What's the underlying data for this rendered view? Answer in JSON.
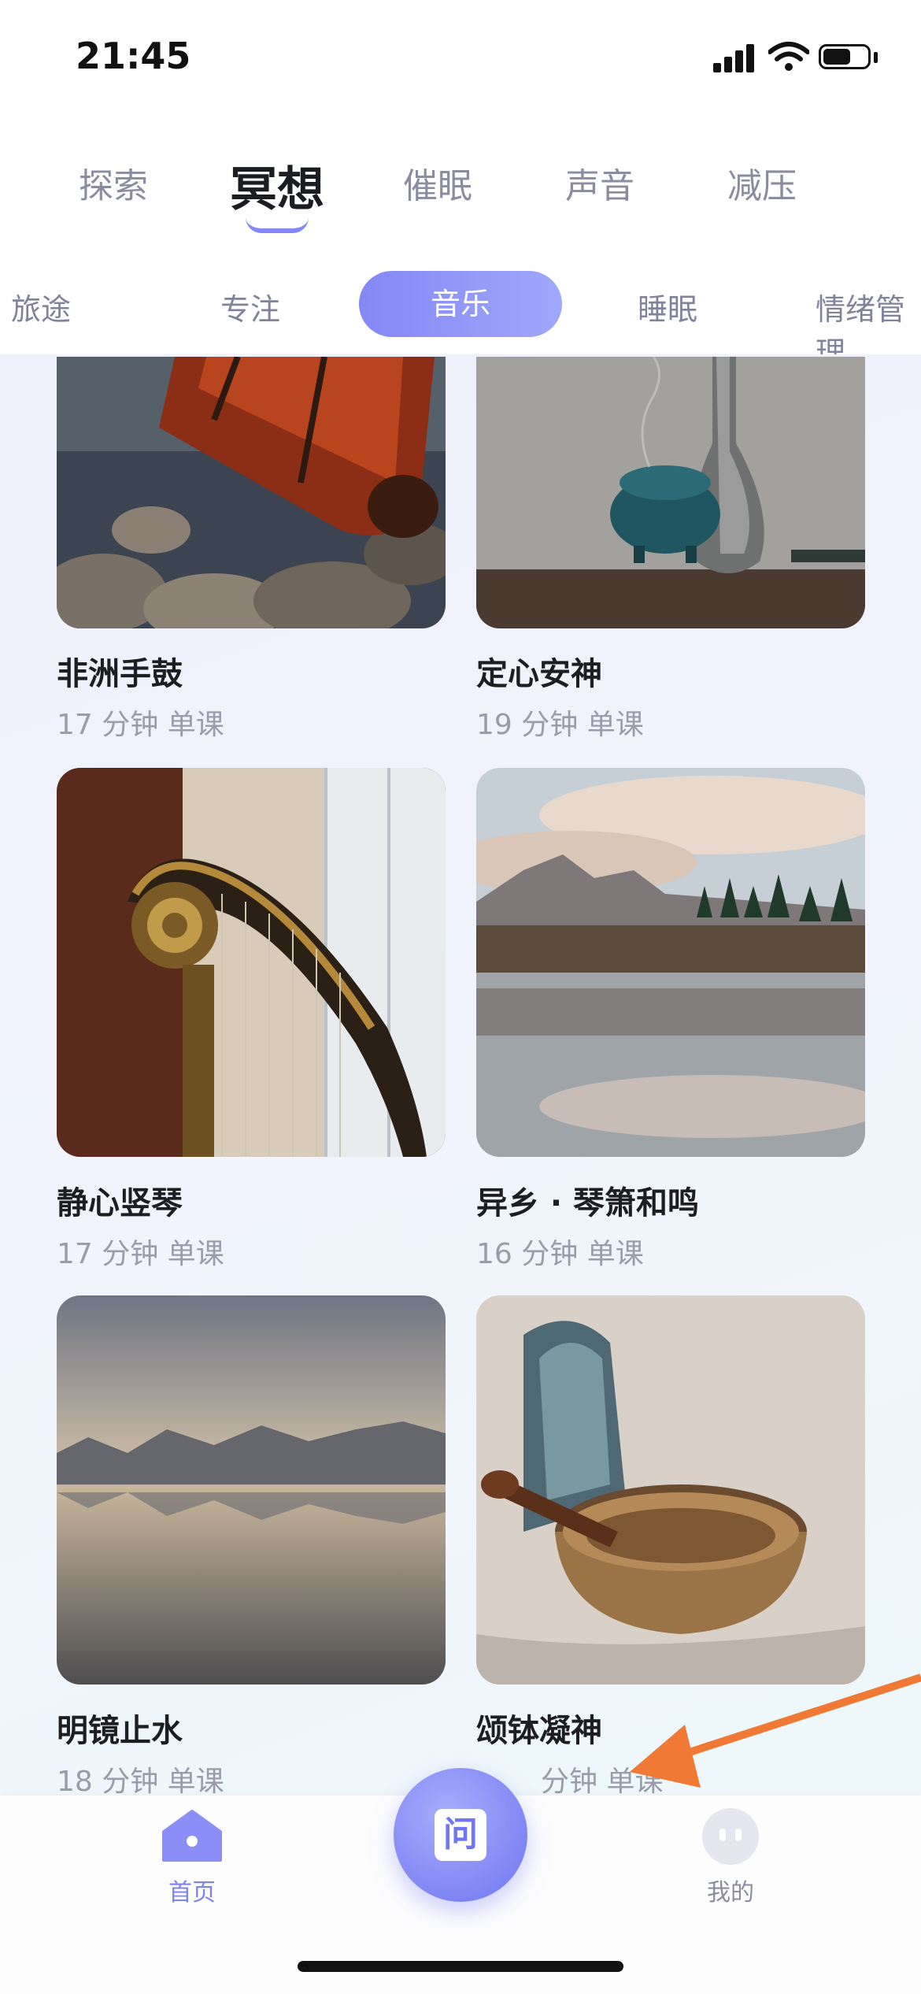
{
  "status": {
    "time": "21:45"
  },
  "top_tabs": [
    {
      "label": "探索"
    },
    {
      "label": "冥想"
    },
    {
      "label": "催眠"
    },
    {
      "label": "声音"
    },
    {
      "label": "减压"
    }
  ],
  "categories": [
    {
      "label": "旅途"
    },
    {
      "label": "专注"
    },
    {
      "label": "音乐"
    },
    {
      "label": "睡眠"
    },
    {
      "label": "情绪管理"
    }
  ],
  "cards": [
    {
      "title": "非洲手鼓",
      "meta": "17 分钟  单课"
    },
    {
      "title": "定心安神",
      "meta": "19 分钟  单课"
    },
    {
      "title": "静心竖琴",
      "meta": "17 分钟  单课"
    },
    {
      "title": "异乡 · 琴箫和鸣",
      "meta": "16 分钟  单课"
    },
    {
      "title": "明镜止水",
      "meta": "18 分钟  单课"
    },
    {
      "title": "颂钵凝神",
      "meta": "分钟  单课"
    }
  ],
  "bottom_nav": {
    "home": "首页",
    "center": "问",
    "mine": "我的"
  },
  "colors": {
    "accent": "#8487f5",
    "annotation_arrow": "#f07a35"
  }
}
